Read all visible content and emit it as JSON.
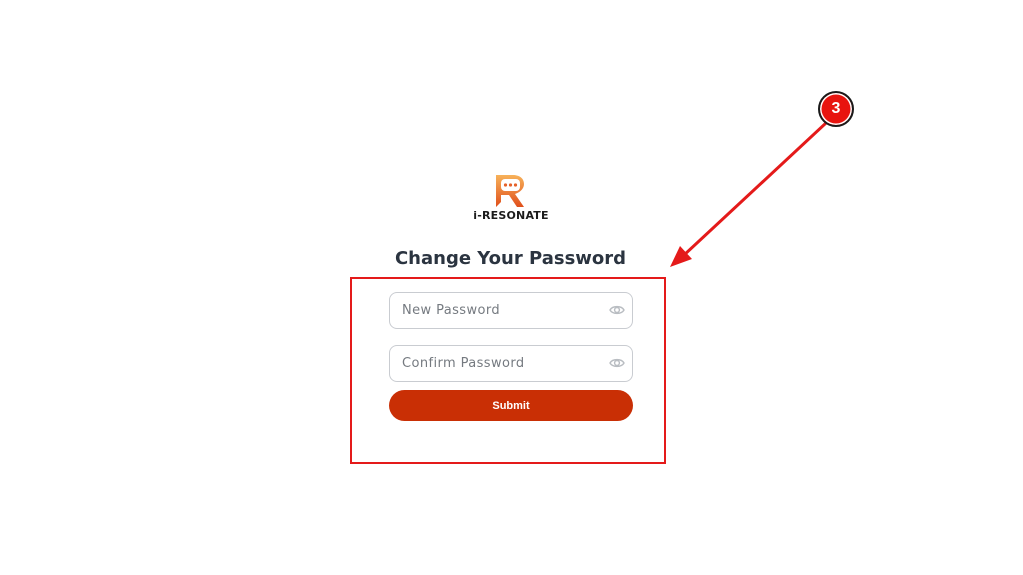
{
  "brand": {
    "name": "i-RESONATE",
    "colors": {
      "logo_top": "#f5a04a",
      "logo_bottom": "#e0531e"
    }
  },
  "heading": "Change Your Password",
  "form": {
    "new_password": {
      "placeholder": "New Password",
      "value": "",
      "icon": "eye-icon"
    },
    "confirm_password": {
      "placeholder": "Confirm Password",
      "value": "",
      "icon": "eye-icon"
    },
    "submit_label": "Submit",
    "submit_color": "#c92f05"
  },
  "annotation": {
    "step_number": "3",
    "color": "#e41a1a"
  }
}
